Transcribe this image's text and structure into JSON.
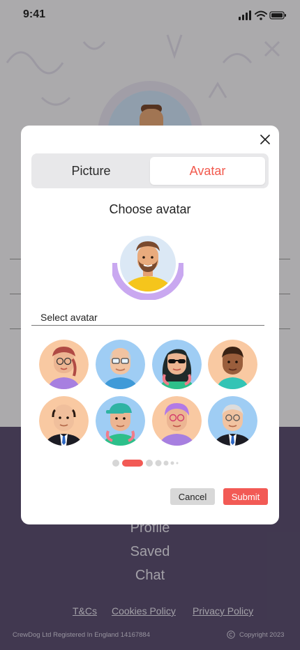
{
  "status_bar": {
    "time": "9:41"
  },
  "background": {
    "footer_links": [
      "Profile",
      "Saved",
      "Chat"
    ],
    "legal_links": [
      "T&Cs",
      "Cookies Policy",
      "Privacy Policy"
    ],
    "company_registration": "CrewDog Ltd Registered In England 14167884",
    "copyright": "Copyright 2023"
  },
  "modal": {
    "tabs": [
      {
        "label": "Picture",
        "active": false
      },
      {
        "label": "Avatar",
        "active": true
      }
    ],
    "title": "Choose avatar",
    "select_label": "Select avatar",
    "avatar_options": [
      {
        "name": "woman-glasses-braid",
        "bg": "#f9c9a2"
      },
      {
        "name": "bald-man-glasses",
        "bg": "#9fcdf4"
      },
      {
        "name": "woman-sunglasses",
        "bg": "#9fcdf4"
      },
      {
        "name": "boy-tank-top",
        "bg": "#f9c9a2"
      },
      {
        "name": "bald-man-suit",
        "bg": "#f9c9a2"
      },
      {
        "name": "man-green-cap",
        "bg": "#9fcdf4"
      },
      {
        "name": "purple-hair-woman",
        "bg": "#f9c9a2"
      },
      {
        "name": "old-man-suit",
        "bg": "#9fcdf4"
      }
    ],
    "pagination": {
      "pages": 7,
      "current": 2
    },
    "cancel_label": "Cancel",
    "submit_label": "Submit"
  },
  "colors": {
    "accent": "#f25a55",
    "footer_bg": "#5d5173",
    "ring": "#c9a8f0"
  }
}
